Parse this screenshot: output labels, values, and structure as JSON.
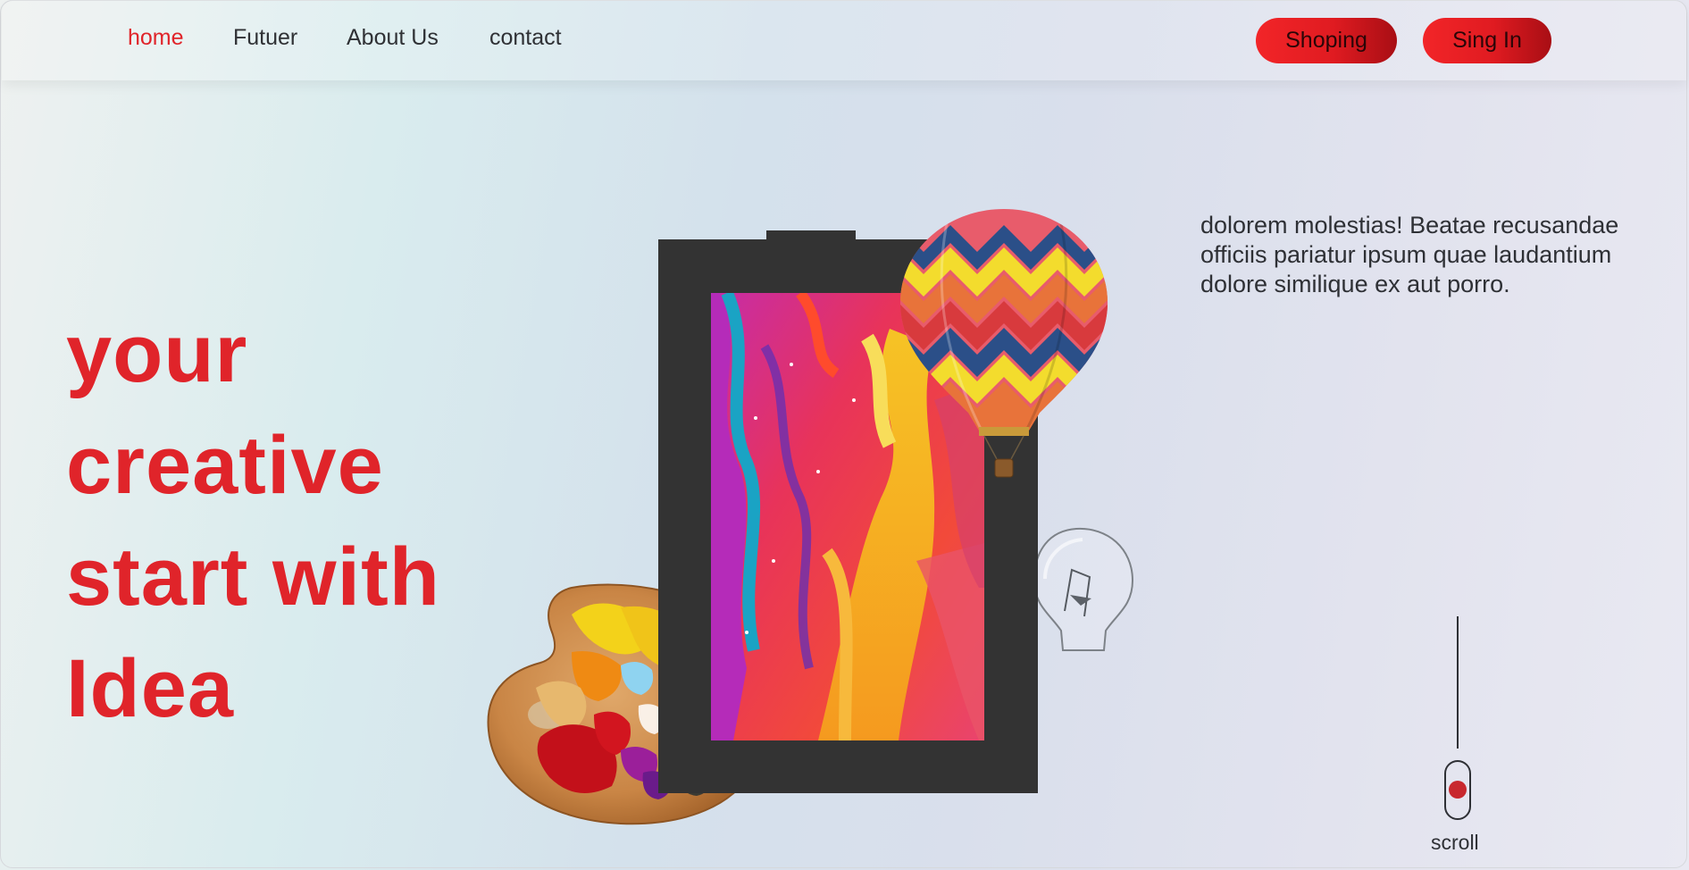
{
  "nav": {
    "links": [
      {
        "label": "home",
        "active": true
      },
      {
        "label": "Futuer",
        "active": false
      },
      {
        "label": "About Us",
        "active": false
      },
      {
        "label": "contact",
        "active": false
      }
    ],
    "buttons": {
      "shopping": "Shoping",
      "sign_in": "Sing In"
    }
  },
  "hero": {
    "headline_lines": [
      "your",
      "creative",
      "start with",
      "Idea"
    ],
    "description": "dolorem molestias! Beatae recusandae officiis pariatur ipsum quae laudantium dolore similique ex aut porro."
  },
  "scroll": {
    "label": "scroll"
  },
  "colors": {
    "accent": "#e0242a",
    "button_gradient_end": "#a80e14",
    "text": "#2f3135",
    "frame": "#333333"
  },
  "icons": [
    "paint-palette-image",
    "hot-air-balloon-image",
    "light-bulb-image",
    "abstract-painting-image",
    "mouse-scroll-icon"
  ]
}
